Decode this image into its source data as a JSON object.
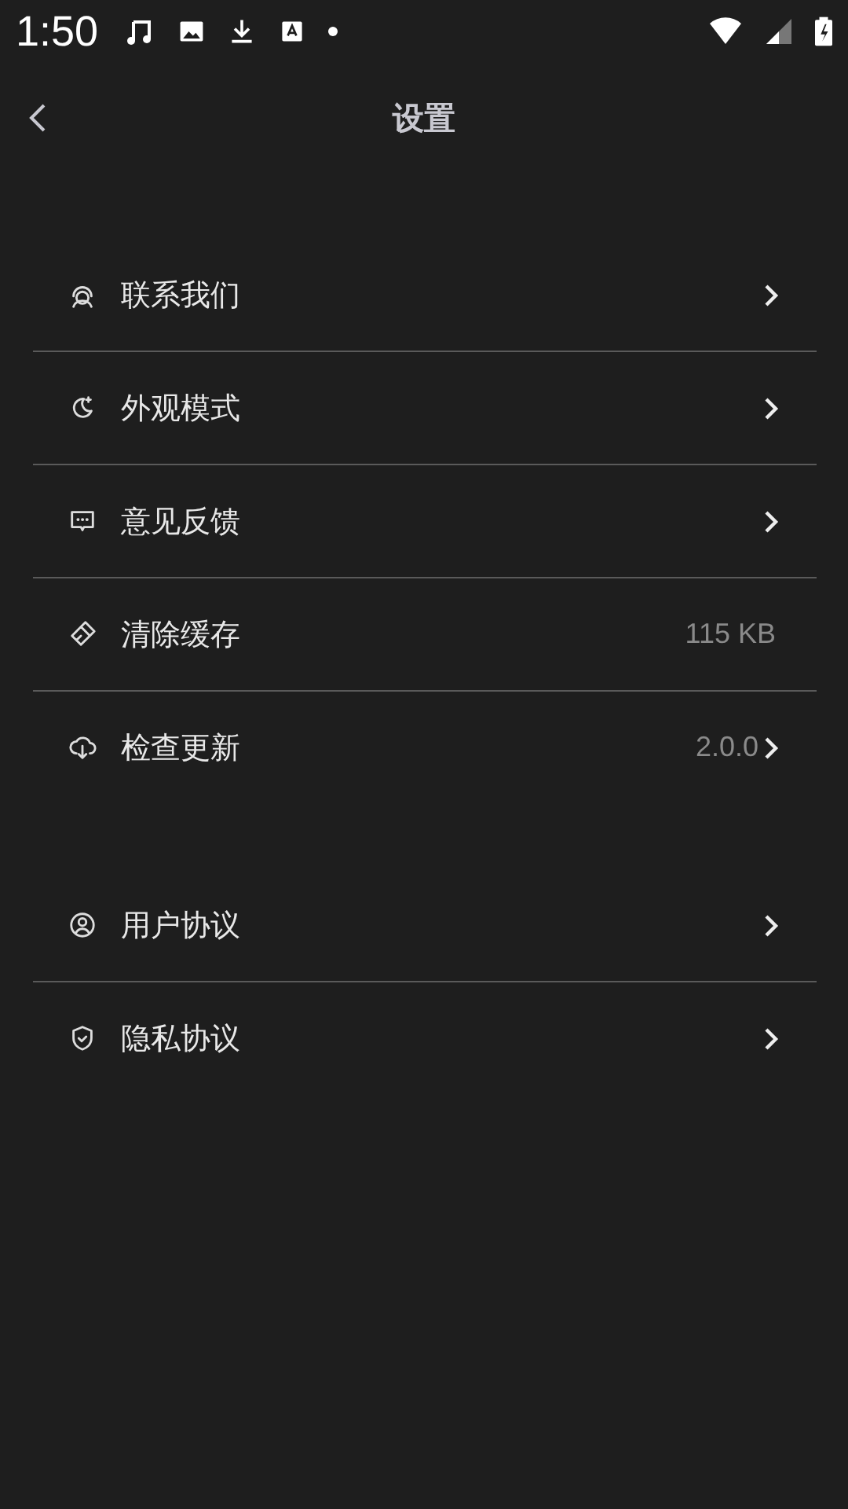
{
  "status_bar": {
    "time": "1:50"
  },
  "header": {
    "title": "设置"
  },
  "sections": [
    {
      "items": [
        {
          "label": "联系我们",
          "arrow": true
        },
        {
          "label": "外观模式",
          "arrow": true
        },
        {
          "label": "意见反馈",
          "arrow": true
        },
        {
          "label": "清除缓存",
          "value": "115 KB",
          "arrow": false
        },
        {
          "label": "检查更新",
          "value": "2.0.0",
          "arrow": true
        }
      ]
    },
    {
      "items": [
        {
          "label": "用户协议",
          "arrow": true
        },
        {
          "label": "隐私协议",
          "arrow": true
        }
      ]
    }
  ]
}
